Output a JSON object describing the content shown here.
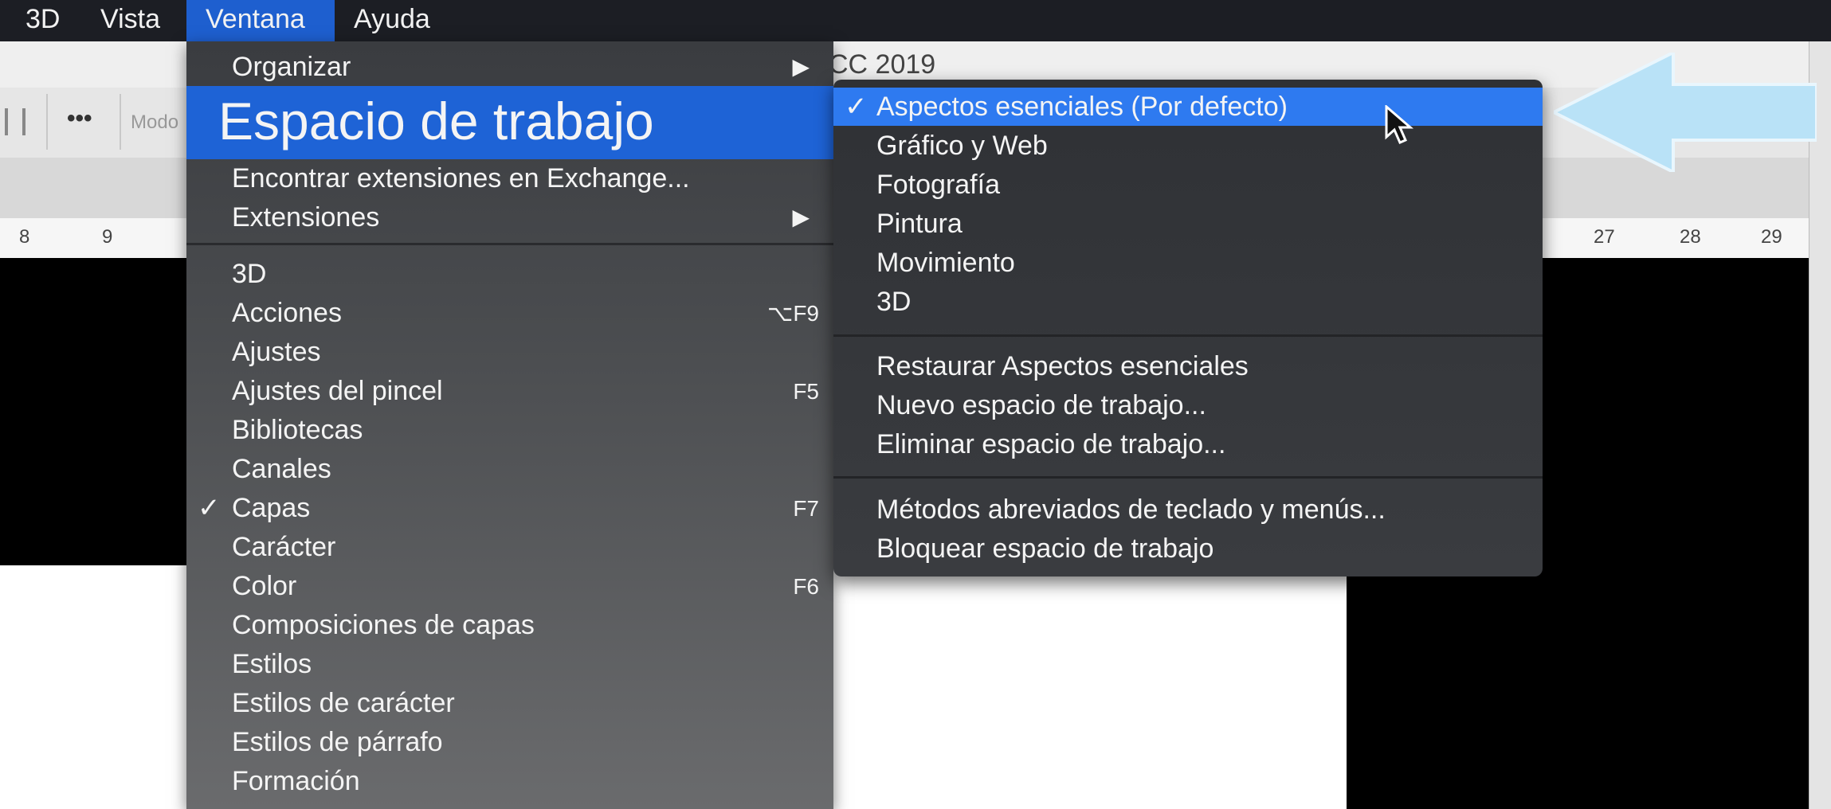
{
  "menubar": {
    "items": [
      "3D",
      "Vista",
      "Ventana",
      "Ayuda"
    ]
  },
  "app": {
    "title_fragment": "CC 2019",
    "toolbar_mode_label": "Modo",
    "toolbar_more": "•••"
  },
  "ruler": {
    "labels": [
      "8",
      "9",
      "27",
      "28",
      "29"
    ]
  },
  "ventana_menu": {
    "organizar": "Organizar",
    "espacio_de_trabajo": "Espacio de trabajo",
    "encontrar_extensiones": "Encontrar extensiones en Exchange...",
    "extensiones": "Extensiones",
    "items": [
      {
        "label": "3D",
        "shortcut": "",
        "checked": false
      },
      {
        "label": "Acciones",
        "shortcut": "⌥F9",
        "checked": false
      },
      {
        "label": "Ajustes",
        "shortcut": "",
        "checked": false
      },
      {
        "label": "Ajustes del pincel",
        "shortcut": "F5",
        "checked": false
      },
      {
        "label": "Bibliotecas",
        "shortcut": "",
        "checked": false
      },
      {
        "label": "Canales",
        "shortcut": "",
        "checked": false
      },
      {
        "label": "Capas",
        "shortcut": "F7",
        "checked": true
      },
      {
        "label": "Carácter",
        "shortcut": "",
        "checked": false
      },
      {
        "label": "Color",
        "shortcut": "F6",
        "checked": false
      },
      {
        "label": "Composiciones de capas",
        "shortcut": "",
        "checked": false
      },
      {
        "label": "Estilos",
        "shortcut": "",
        "checked": false
      },
      {
        "label": "Estilos de carácter",
        "shortcut": "",
        "checked": false
      },
      {
        "label": "Estilos de párrafo",
        "shortcut": "",
        "checked": false
      },
      {
        "label": "Formación",
        "shortcut": "",
        "checked": false
      }
    ],
    "check_glyph": "✓",
    "arrow_glyph": "▶"
  },
  "workspace_submenu": {
    "group1": [
      "Aspectos esenciales (Por defecto)",
      "Gráfico y Web",
      "Fotografía",
      "Pintura",
      "Movimiento",
      "3D"
    ],
    "group2": [
      "Restaurar Aspectos esenciales",
      "Nuevo espacio de trabajo...",
      "Eliminar espacio de trabajo..."
    ],
    "group3": [
      "Métodos abreviados de teclado y menús...",
      "Bloquear espacio de trabajo"
    ],
    "checked_index": 0
  },
  "colors": {
    "menu_highlight": "#1e63d6",
    "submenu_highlight": "#2e7af0",
    "annotation_arrow": "#b9e2f7"
  }
}
